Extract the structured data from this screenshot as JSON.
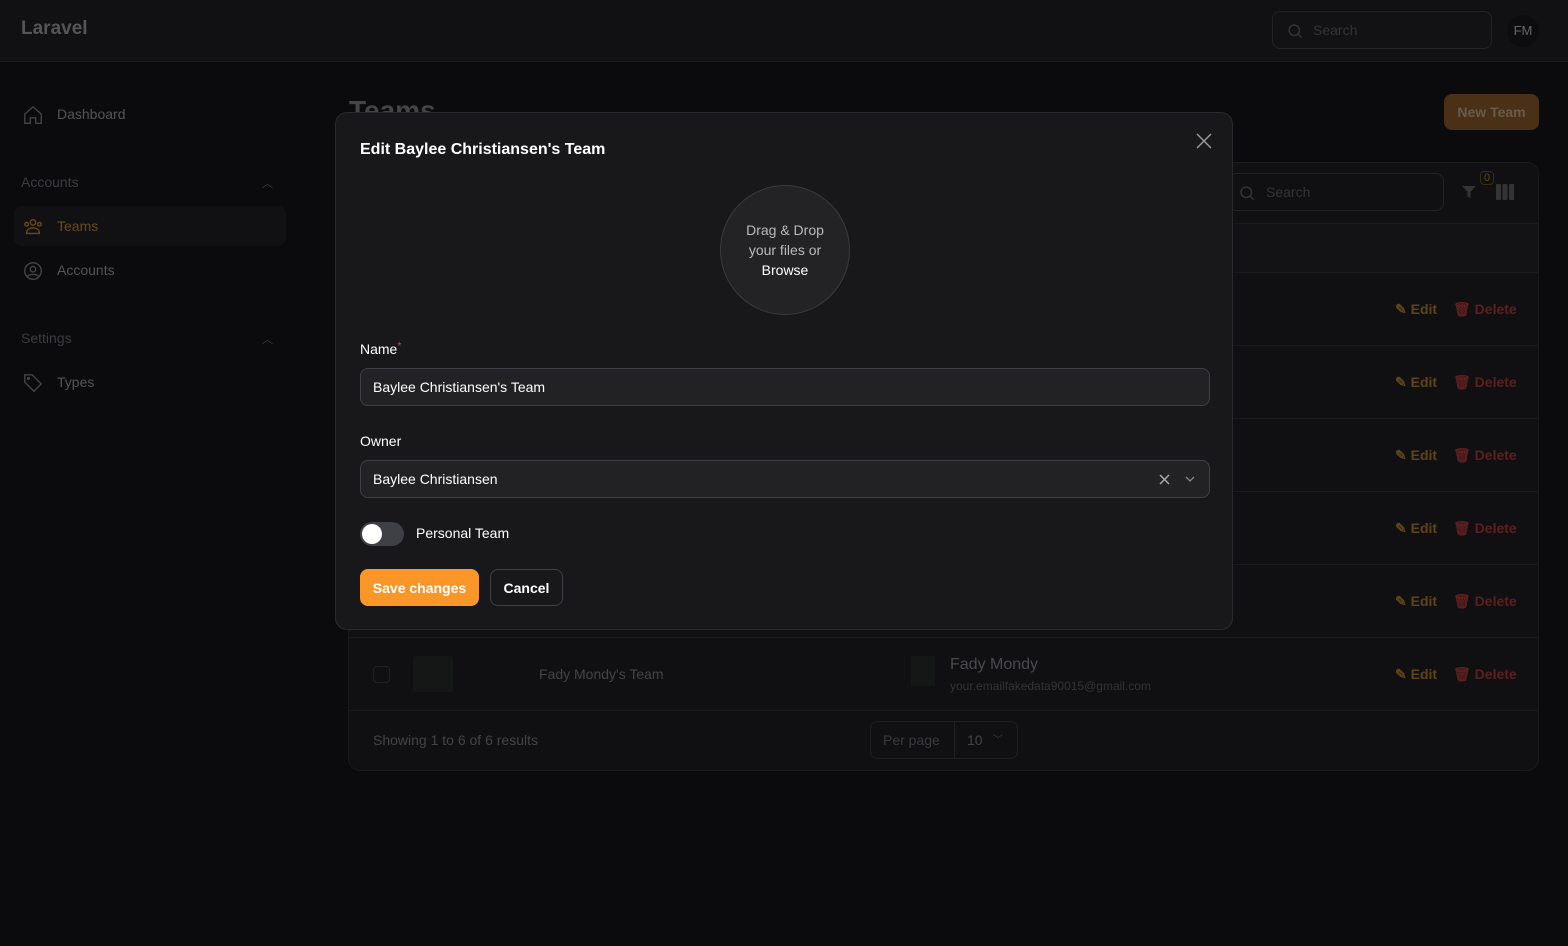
{
  "app": {
    "logo": "Laravel",
    "search_placeholder": "Search",
    "avatar_initials": "FM"
  },
  "sidebar": {
    "dashboard": "Dashboard",
    "groups": [
      {
        "label": "Accounts",
        "items": [
          {
            "label": "Teams",
            "active": true
          },
          {
            "label": "Accounts"
          }
        ]
      },
      {
        "label": "Settings",
        "items": [
          {
            "label": "Types"
          }
        ]
      }
    ]
  },
  "page": {
    "title": "Teams",
    "new_button": "New Team"
  },
  "table": {
    "search_placeholder": "Search",
    "filter_count": "0",
    "edit_label": "Edit",
    "delete_label": "Delete",
    "visible_row": {
      "team": "Fady Mondy's Team",
      "owner_name": "Fady Mondy",
      "owner_email": "your.emailfakedata90015@gmail.com"
    },
    "footer": "Showing 1 to 6 of 6 results",
    "per_page_label": "Per page",
    "per_page_value": "10"
  },
  "modal": {
    "title": "Edit Baylee Christiansen's Team",
    "upload_line1": "Drag & Drop",
    "upload_line2": "your files or",
    "upload_browse": "Browse",
    "name_label": "Name",
    "required_mark": "*",
    "name_value": "Baylee Christiansen's Team",
    "owner_label": "Owner",
    "owner_value": "Baylee Christiansen",
    "personal_label": "Personal Team",
    "personal_on": false,
    "save": "Save changes",
    "cancel": "Cancel"
  },
  "colors": {
    "accent": "#fb9629",
    "danger": "#ef4444"
  }
}
